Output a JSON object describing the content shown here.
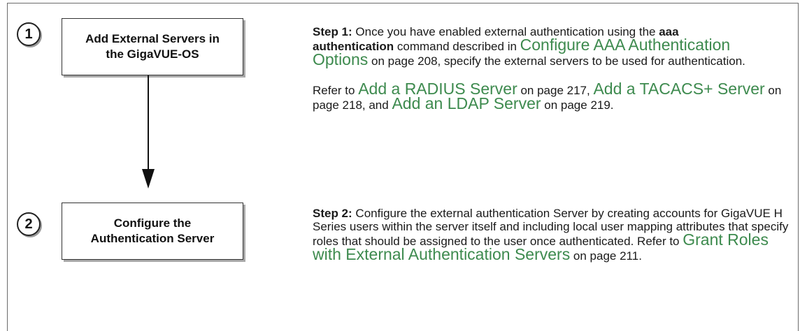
{
  "steps": [
    {
      "number": "1",
      "box_label_line1": "Add External Servers in",
      "box_label_line2": "the GigaVUE-OS",
      "step_label": "Step 1:",
      "t1": " Once you have enabled external authentication using the ",
      "cmd_a": "aaa",
      "cmd_b": "authentication",
      "t2": " command described in ",
      "link1": "Configure AAA Authentication Options",
      "t3": " on page 208, specify the external servers to be used for authentication.",
      "refer": "Refer to ",
      "link2": "Add a RADIUS Server",
      "t4": " on page 217, ",
      "link3": "Add a TACACS+ Server",
      "t5": " on page 218, and ",
      "link4": "Add an LDAP Server",
      "t6": " on page 219."
    },
    {
      "number": "2",
      "box_label_line1": "Configure the",
      "box_label_line2": "Authentication Server",
      "step_label": "Step 2:",
      "t1": " Configure the external authentication Server by creating accounts for GigaVUE H Series users within the server itself and including local user mapping attributes that specify roles that should be assigned to the user once authenticated. Refer to ",
      "link1": "Grant Roles with External Authentication Servers",
      "t2": " on page 211."
    }
  ],
  "colors": {
    "link": "#3d8a4e",
    "border": "#333333",
    "shadow": "#a8a8a8"
  }
}
